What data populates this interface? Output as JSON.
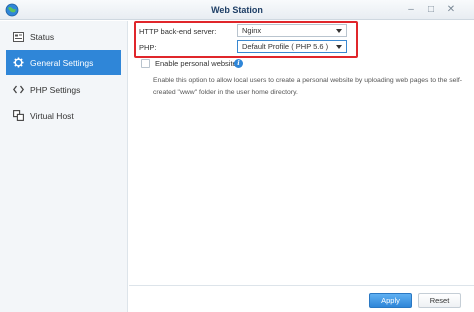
{
  "window": {
    "title": "Web Station",
    "controls": [
      "minimize-icon",
      "maximize-icon",
      "close-icon"
    ],
    "control_glyphs": {
      "minimize": "–",
      "maximize": "□",
      "close": "✕"
    }
  },
  "sidebar": {
    "items": [
      {
        "label": "Status",
        "icon": "status-icon",
        "active": false
      },
      {
        "label": "General Settings",
        "icon": "gear-icon",
        "active": true
      },
      {
        "label": "PHP Settings",
        "icon": "code-brackets-icon",
        "active": false
      },
      {
        "label": "Virtual Host",
        "icon": "virtual-host-icon",
        "active": false
      }
    ]
  },
  "form": {
    "http_server_label": "HTTP back-end server:",
    "http_server_value": "Nginx",
    "php_label": "PHP:",
    "php_value": "Default Profile ( PHP 5.6 )",
    "personal_website_label": "Enable personal website",
    "personal_website_checked": false,
    "description": "Enable this option to allow local users to create a personal website by uploading web pages to the self-created \"www\" folder in the user home directory."
  },
  "footer": {
    "apply_label": "Apply",
    "reset_label": "Reset"
  },
  "colors": {
    "accent": "#2f86d8",
    "highlight_border": "#e0262b",
    "title_text": "#1f3f66"
  }
}
